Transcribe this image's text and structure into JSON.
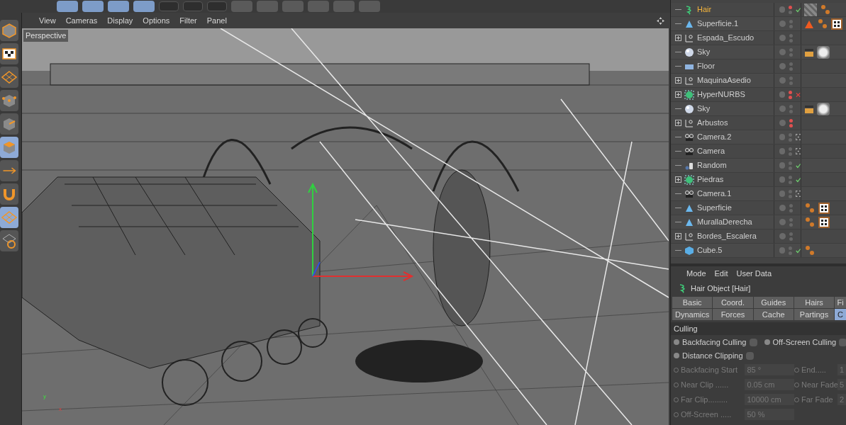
{
  "viewport": {
    "menu": [
      "View",
      "Cameras",
      "Display",
      "Options",
      "Filter",
      "Panel"
    ],
    "camera_label": "Perspective",
    "axis_labels": [
      "y",
      "x"
    ]
  },
  "left_tools": [
    {
      "kind": "cube",
      "selected": false
    },
    {
      "kind": "checker",
      "selected": false
    },
    {
      "kind": "grid",
      "selected": false
    },
    {
      "kind": "points",
      "selected": false
    },
    {
      "kind": "edges",
      "selected": false
    },
    {
      "kind": "polygons",
      "selected": true
    },
    {
      "kind": "arrow",
      "selected": false
    },
    {
      "kind": "magnet",
      "selected": false
    },
    {
      "kind": "grid",
      "selected": true
    },
    {
      "kind": "rotate-grid",
      "selected": false
    }
  ],
  "objects": [
    {
      "name": "Hair",
      "kind": "hair",
      "expandable": false,
      "selected": true,
      "editor_hidden": true,
      "render_hidden": false,
      "status": {
        "kind": "check"
      },
      "tags": [
        {
          "kind": "hatch"
        },
        {
          "kind": "phong"
        }
      ]
    },
    {
      "name": "Superficie.1",
      "kind": "cone",
      "expandable": false,
      "selected": false,
      "editor_hidden": false,
      "render_hidden": false,
      "tags": [
        {
          "kind": "triangle"
        },
        {
          "kind": "phong"
        },
        {
          "kind": "texture"
        }
      ]
    },
    {
      "name": "Espada_Escudo",
      "kind": "null",
      "expandable": true,
      "selected": false,
      "editor_hidden": false,
      "render_hidden": false
    },
    {
      "name": "Sky",
      "kind": "sphere",
      "expandable": false,
      "selected": false,
      "editor_hidden": false,
      "render_hidden": false,
      "tags": [
        {
          "kind": "clapper"
        },
        {
          "kind": "sky"
        }
      ]
    },
    {
      "name": "Floor",
      "kind": "floor",
      "expandable": false,
      "selected": false,
      "editor_hidden": false,
      "render_hidden": false
    },
    {
      "name": "MaquinaAsedio",
      "kind": "null",
      "expandable": true,
      "selected": false,
      "editor_hidden": false,
      "render_hidden": false
    },
    {
      "name": "HyperNURBS",
      "kind": "nurbs",
      "expandable": true,
      "selected": false,
      "editor_hidden": true,
      "render_hidden": true,
      "status": {
        "kind": "cross"
      }
    },
    {
      "name": "Sky",
      "kind": "sphere",
      "expandable": false,
      "selected": false,
      "editor_hidden": false,
      "render_hidden": false,
      "tags": [
        {
          "kind": "clapper"
        },
        {
          "kind": "sky"
        }
      ]
    },
    {
      "name": "Arbustos",
      "kind": "null",
      "expandable": true,
      "selected": false,
      "editor_hidden": true,
      "render_hidden": true
    },
    {
      "name": "Camera.2",
      "kind": "camera",
      "expandable": false,
      "selected": false,
      "editor_hidden": false,
      "render_hidden": false,
      "status": {
        "kind": "target"
      }
    },
    {
      "name": "Camera",
      "kind": "camera",
      "expandable": false,
      "selected": false,
      "editor_hidden": false,
      "render_hidden": false,
      "status": {
        "kind": "target"
      }
    },
    {
      "name": "Random",
      "kind": "random",
      "expandable": false,
      "selected": false,
      "editor_hidden": false,
      "render_hidden": false,
      "status": {
        "kind": "check"
      }
    },
    {
      "name": "Piedras",
      "kind": "nurbs",
      "expandable": true,
      "selected": false,
      "editor_hidden": false,
      "render_hidden": false,
      "status": {
        "kind": "check"
      }
    },
    {
      "name": "Camera.1",
      "kind": "camera",
      "expandable": false,
      "selected": false,
      "editor_hidden": false,
      "render_hidden": false,
      "status": {
        "kind": "target"
      }
    },
    {
      "name": "Superficie",
      "kind": "cone",
      "expandable": false,
      "selected": false,
      "editor_hidden": false,
      "render_hidden": false,
      "tags": [
        {
          "kind": "phong"
        },
        {
          "kind": "texture"
        }
      ]
    },
    {
      "name": "MurallaDerecha",
      "kind": "cone",
      "expandable": false,
      "selected": false,
      "editor_hidden": false,
      "render_hidden": false,
      "tags": [
        {
          "kind": "phong"
        },
        {
          "kind": "texture"
        }
      ]
    },
    {
      "name": "Bordes_Escalera",
      "kind": "null",
      "expandable": true,
      "selected": false,
      "editor_hidden": false,
      "render_hidden": false
    },
    {
      "name": "Cube.5",
      "kind": "cube",
      "expandable": false,
      "selected": false,
      "editor_hidden": false,
      "render_hidden": false,
      "status": {
        "kind": "check"
      },
      "tags": [
        {
          "kind": "phong"
        }
      ]
    }
  ],
  "attributes": {
    "menu": [
      "Mode",
      "Edit",
      "User Data"
    ],
    "title": "Hair Object [Hair]",
    "tab_rows": [
      [
        {
          "label": "Basic",
          "selected": false
        },
        {
          "label": "Coord.",
          "selected": false
        },
        {
          "label": "Guides",
          "selected": false
        },
        {
          "label": "Hairs",
          "selected": false
        },
        {
          "label": "Fi",
          "selected": false
        }
      ],
      [
        {
          "label": "Dynamics",
          "selected": false
        },
        {
          "label": "Forces",
          "selected": false
        },
        {
          "label": "Cache",
          "selected": false
        },
        {
          "label": "Partings",
          "selected": false
        },
        {
          "label": "C",
          "selected": true
        }
      ]
    ],
    "section": "Culling",
    "checks": [
      [
        {
          "label": "Backfacing Culling",
          "checked": false
        },
        {
          "label": "Off-Screen Culling",
          "checked": false
        }
      ],
      [
        {
          "label": "Distance Clipping",
          "checked": false
        }
      ]
    ],
    "fields": [
      [
        {
          "label": "Backfacing Start",
          "value": "85 °",
          "disabled": true
        },
        {
          "label": "End.....",
          "value": "1",
          "disabled": true
        }
      ],
      [
        {
          "label": "Near Clip ......",
          "value": "0.05 cm",
          "disabled": true
        },
        {
          "label": "Near Fade",
          "value": "5",
          "disabled": true
        }
      ],
      [
        {
          "label": "Far Clip.........",
          "value": "10000 cm",
          "disabled": true
        },
        {
          "label": "Far Fade",
          "value": "2",
          "disabled": true
        }
      ],
      [
        {
          "label": "Off-Screen .....",
          "value": "50 %",
          "disabled": true
        }
      ]
    ]
  }
}
